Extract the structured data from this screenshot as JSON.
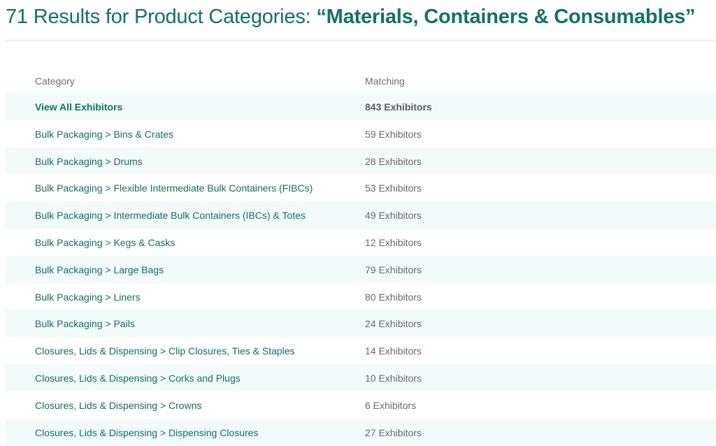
{
  "header": {
    "title_prefix": "71 Results for Product Categories: ",
    "title_query": "“Materials, Containers & Consumables”"
  },
  "table": {
    "columns": {
      "category": "Category",
      "matching": "Matching"
    },
    "rows": [
      {
        "category": "View All Exhibitors",
        "matching": "843 Exhibitors"
      },
      {
        "category": "Bulk Packaging > Bins & Crates",
        "matching": "59 Exhibitors"
      },
      {
        "category": "Bulk Packaging > Drums",
        "matching": "28 Exhibitors"
      },
      {
        "category": "Bulk Packaging > Flexible Intermediate Bulk Containers (FIBCs)",
        "matching": "53 Exhibitors"
      },
      {
        "category": "Bulk Packaging > Intermediate Bulk Containers (IBCs) & Totes",
        "matching": "49 Exhibitors"
      },
      {
        "category": "Bulk Packaging > Kegs & Casks",
        "matching": "12 Exhibitors"
      },
      {
        "category": "Bulk Packaging > Large Bags",
        "matching": "79 Exhibitors"
      },
      {
        "category": "Bulk Packaging > Liners",
        "matching": "80 Exhibitors"
      },
      {
        "category": "Bulk Packaging > Pails",
        "matching": "24 Exhibitors"
      },
      {
        "category": "Closures, Lids & Dispensing > Clip Closures, Ties & Staples",
        "matching": "14 Exhibitors"
      },
      {
        "category": "Closures, Lids & Dispensing > Corks and Plugs",
        "matching": "10 Exhibitors"
      },
      {
        "category": "Closures, Lids & Dispensing > Crowns",
        "matching": "6 Exhibitors"
      },
      {
        "category": "Closures, Lids & Dispensing > Dispensing Closures",
        "matching": "27 Exhibitors"
      }
    ]
  },
  "colors": {
    "accent": "#0d7563",
    "row_shade": "#f2fbf9",
    "muted_text": "#6a6a6a"
  }
}
